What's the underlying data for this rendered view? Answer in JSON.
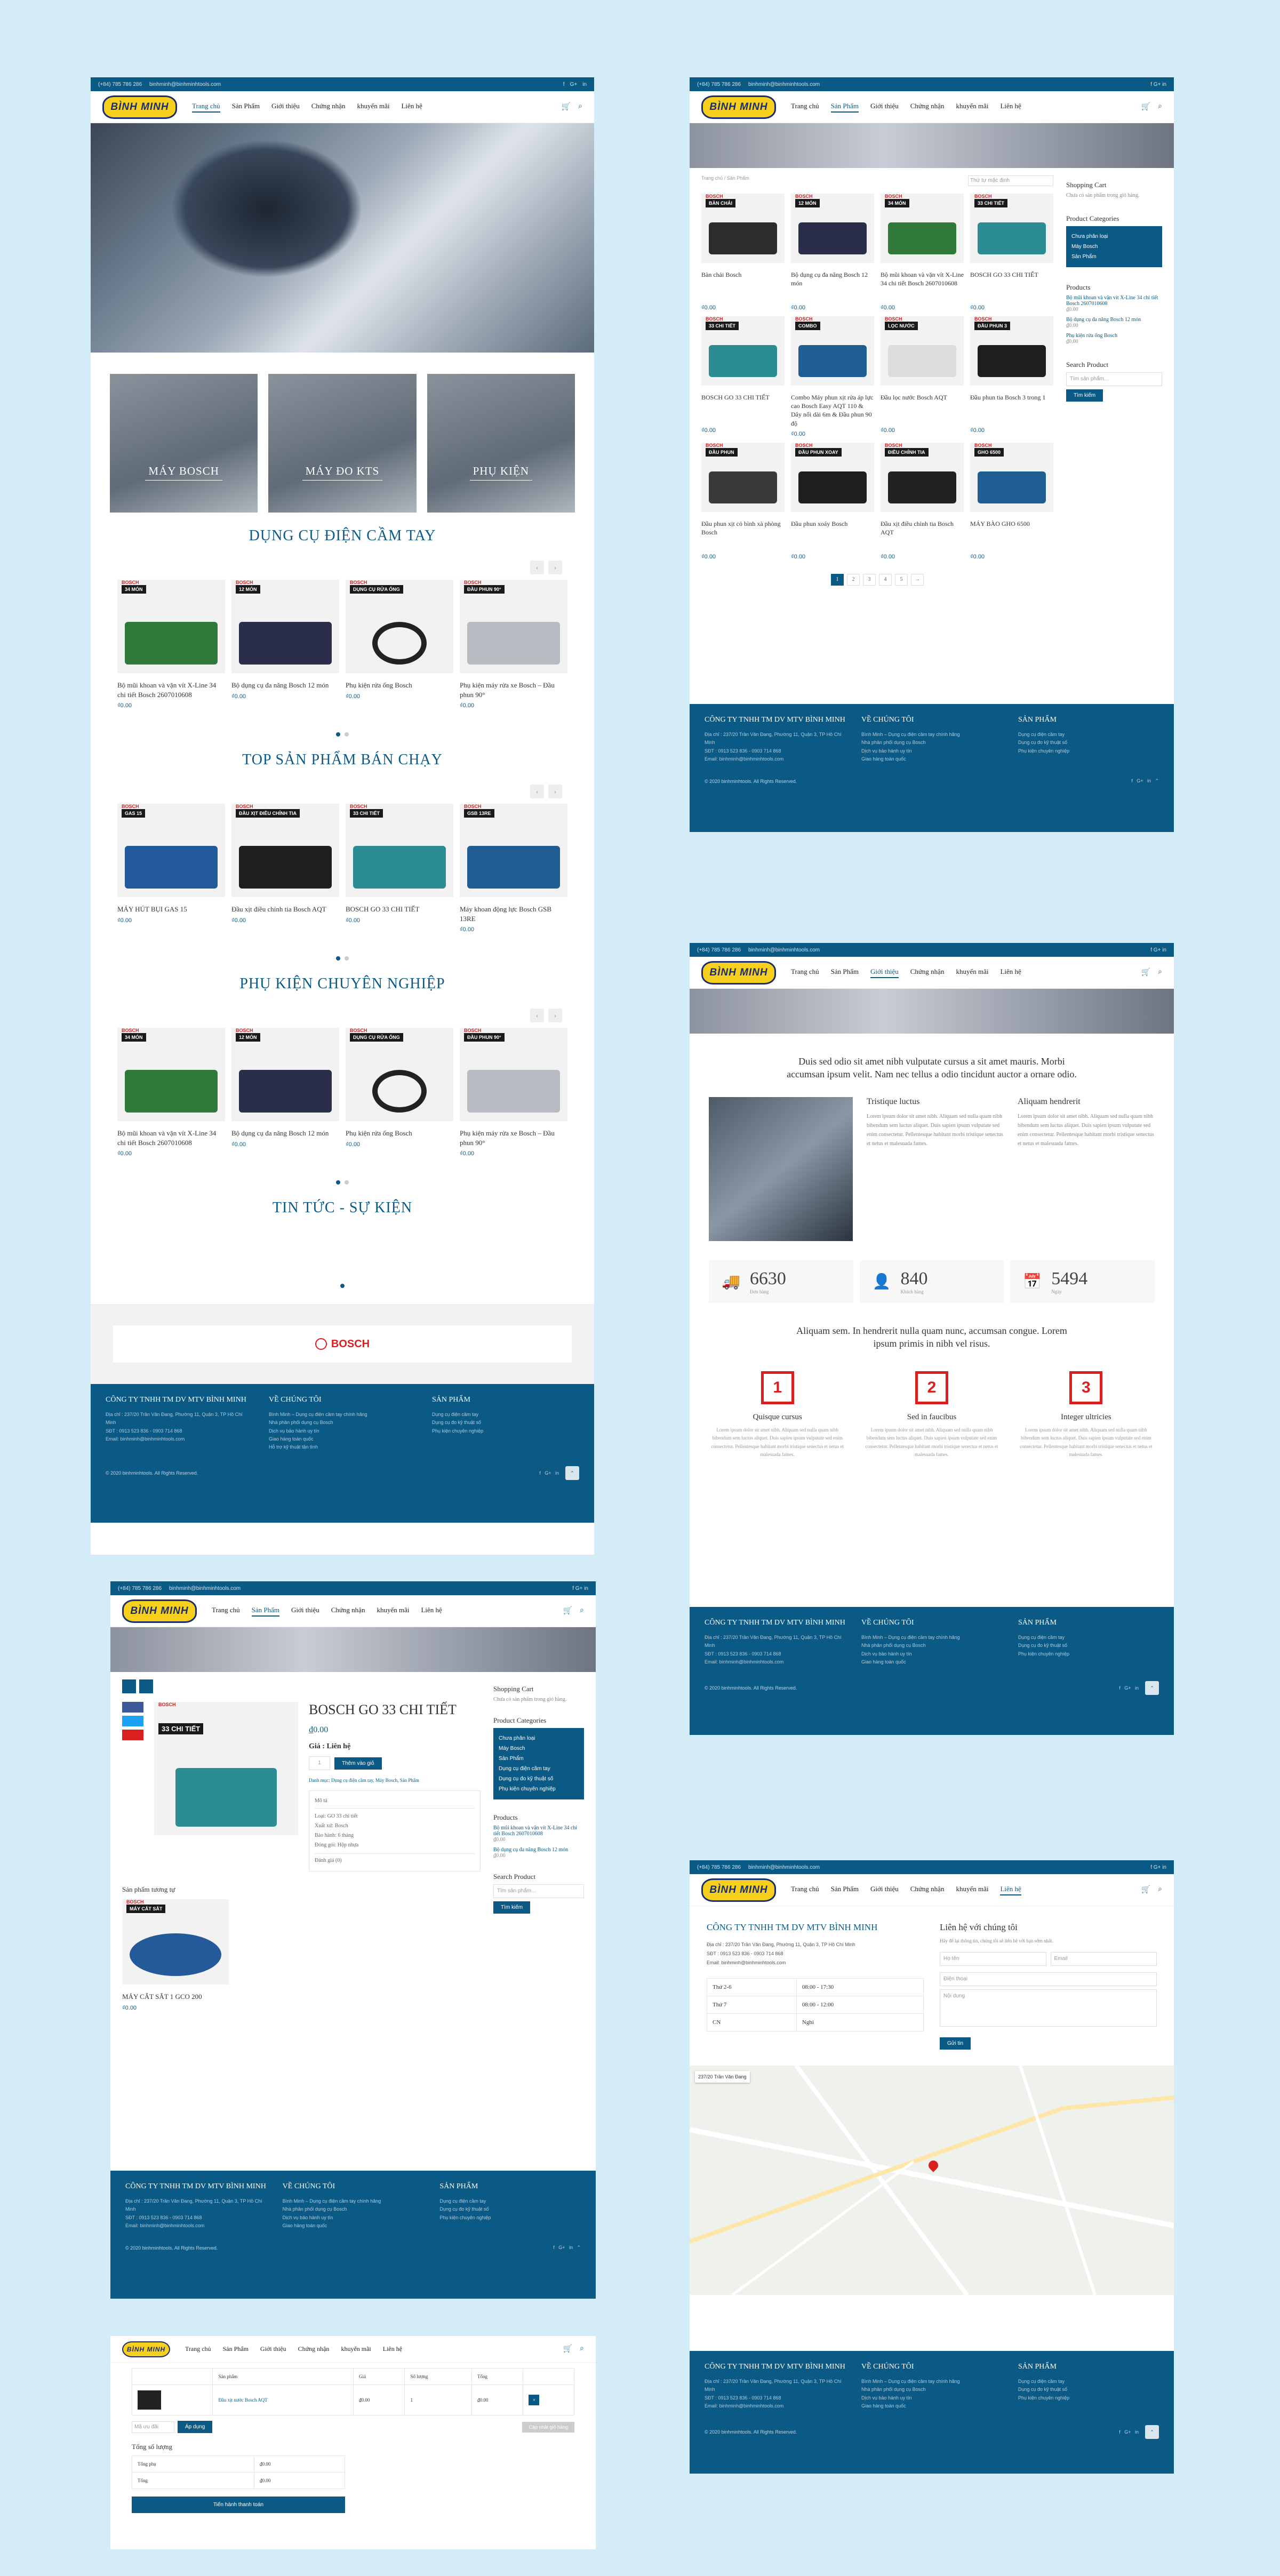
{
  "topbar": {
    "phone": "(+84) 785 786 286",
    "email": "binhminh@binhminhtools.com",
    "social": [
      "f",
      "G+",
      "in"
    ]
  },
  "logo": "BÌNH MINH",
  "menu": [
    "Trang chủ",
    "Sản Phẩm",
    "Giới thiệu",
    "Chứng nhận",
    "khuyến mãi",
    "Liên hệ"
  ],
  "cart": {
    "count": "0",
    "icon": "cart-icon",
    "search_icon": "search-icon"
  },
  "home": {
    "categories": [
      "MÁY BOSCH",
      "MÁY ĐO KTS",
      "PHỤ KIỆN"
    ],
    "sections": [
      {
        "title": "DỤNG CỤ ĐIỆN CẦM TAY",
        "products": [
          {
            "tag": "34 MÓN",
            "name": "Bộ mũi khoan và vặn vít X-Line 34 chi tiết Bosch 2607010608",
            "price": "₫0.00"
          },
          {
            "tag": "12 MÓN",
            "name": "Bộ dụng cụ đa năng Bosch 12 món",
            "price": "₫0.00"
          },
          {
            "tag": "DỤNG CỤ RỬA ỐNG",
            "name": "Phụ kiện rửa ống Bosch",
            "price": "₫0.00"
          },
          {
            "tag": "ĐẦU PHUN 90°",
            "name": "Phụ kiện máy rửa xe Bosch – Đầu phun 90°",
            "price": "₫0.00"
          }
        ]
      },
      {
        "title": "TOP SẢN PHẨM BÁN CHẠY",
        "products": [
          {
            "tag": "GAS 15",
            "name": "MÁY HÚT BỤI GAS 15",
            "price": "₫0.00"
          },
          {
            "tag": "ĐẦU XỊT ĐIỀU CHỈNH TIA",
            "name": "Đầu xịt điều chỉnh tia Bosch AQT",
            "price": "₫0.00"
          },
          {
            "tag": "33 CHI TIẾT",
            "name": "BOSCH GO 33 CHI TIẾT",
            "price": "₫0.00"
          },
          {
            "tag": "GSB 13RE",
            "name": "Máy khoan động lực Bosch GSB 13RE",
            "price": "₫0.00"
          }
        ]
      },
      {
        "title": "PHỤ KIỆN CHUYÊN NGHIỆP",
        "products": [
          {
            "tag": "34 MÓN",
            "name": "Bộ mũi khoan và vặn vít X-Line 34 chi tiết Bosch 2607010608",
            "price": "₫0.00"
          },
          {
            "tag": "12 MÓN",
            "name": "Bộ dụng cụ đa năng Bosch 12 món",
            "price": "₫0.00"
          },
          {
            "tag": "DỤNG CỤ RỬA ỐNG",
            "name": "Phụ kiện rửa ống Bosch",
            "price": "₫0.00"
          },
          {
            "tag": "ĐẦU PHUN 90°",
            "name": "Phụ kiện máy rửa xe Bosch – Đầu phun 90°",
            "price": "₫0.00"
          }
        ]
      }
    ],
    "news_title": "TIN TỨC - SỰ KIỆN",
    "partner": "BOSCH"
  },
  "footer": {
    "company": "CÔNG TY TNHH TM DV MTV BÌNH MINH",
    "address": "Địa chỉ : 237/20 Trần Văn Đang, Phường 11, Quận 3, TP Hồ Chí Minh",
    "phone": "SĐT : 0913 523 836 - 0903 714 868",
    "email": "Email: binhminh@binhminhtools.com",
    "about_title": "VỀ CHÚNG TÔI",
    "about": [
      "Bình Minh – Dụng cụ điện cầm tay chính hãng",
      "Nhà phân phối dụng cụ Bosch",
      "Dịch vụ bảo hành uy tín",
      "Giao hàng toàn quốc",
      "Hỗ trợ kỹ thuật tận tình"
    ],
    "products_title": "SẢN PHẨM",
    "products": [
      "Dụng cụ điện cầm tay",
      "Dụng cụ đo kỹ thuật số",
      "Phụ kiện chuyên nghiệp"
    ],
    "copyright": "© 2020 binhminhtools. All Rights Reserved."
  },
  "shop": {
    "breadcrumb": "Trang chủ / Sản Phẩm",
    "sort": "Thứ tự mặc định",
    "products": [
      {
        "tag": "BÀN CHẢI",
        "name": "Bàn chải Bosch",
        "price": "₫0.00"
      },
      {
        "tag": "12 MÓN",
        "name": "Bộ dụng cụ đa năng Bosch 12 món",
        "price": "₫0.00"
      },
      {
        "tag": "34 MÓN",
        "name": "Bộ mũi khoan và vặn vít X-Line 34 chi tiết Bosch 2607010608",
        "price": "₫0.00"
      },
      {
        "tag": "33 CHI TIẾT",
        "name": "BOSCH GO 33 CHI TIẾT",
        "price": "₫0.00"
      },
      {
        "tag": "33 CHI TIẾT",
        "name": "BOSCH GO 33 CHI TIẾT",
        "price": "₫0.00"
      },
      {
        "tag": "COMBO",
        "name": "Combo Máy phun xịt rửa áp lực cao Bosch Easy AQT 110 & Dây nối dài 6m & Đầu phun 90 độ",
        "price": "₫0.00"
      },
      {
        "tag": "LỌC NƯỚC",
        "name": "Đầu lọc nước Bosch AQT",
        "price": "₫0.00"
      },
      {
        "tag": "ĐẦU PHUN 3",
        "name": "Đầu phun tia Bosch 3 trong 1",
        "price": "₫0.00"
      },
      {
        "tag": "ĐẦU PHUN",
        "name": "Đầu phun xịt cỏ bình xà phòng Bosch",
        "price": "₫0.00"
      },
      {
        "tag": "ĐẦU PHUN XOAY",
        "name": "Đầu phun xoáy Bosch",
        "price": "₫0.00"
      },
      {
        "tag": "ĐIỀU CHỈNH TIA",
        "name": "Đầu xịt điều chỉnh tia Bosch AQT",
        "price": "₫0.00"
      },
      {
        "tag": "GHO 6500",
        "name": "MÁY BÀO GHO 6500",
        "price": "₫0.00"
      }
    ],
    "pages": [
      "1",
      "2",
      "3",
      "4",
      "5",
      "→"
    ],
    "side": {
      "cart_title": "Shopping Cart",
      "cart_empty": "Chưa có sản phẩm trong giỏ hàng.",
      "cat_title": "Product Categories",
      "cats": [
        "Chưa phân loại",
        "Máy Bosch",
        "Sản Phẩm"
      ],
      "prod_title": "Products",
      "prods": [
        {
          "name": "Bộ mũi khoan và vặn vít X-Line 34 chi tiết Bosch 2607010608",
          "price": "₫0.00"
        },
        {
          "name": "Bộ dụng cụ đa năng Bosch 12 món",
          "price": "₫0.00"
        },
        {
          "name": "Phụ kiện rửa ống Bosch",
          "price": "₫0.00"
        }
      ],
      "search_title": "Search Product",
      "search_ph": "Tìm sản phẩm…",
      "search_btn": "Tìm kiếm"
    }
  },
  "about": {
    "intro": "Duis sed odio sit amet nibh vulputate cursus a sit amet mauris. Morbi accumsan ipsum velit. Nam nec tellus a odio tincidunt auctor a ornare odio.",
    "col1_title": "Tristique luctus",
    "col2_title": "Aliquam hendrerit",
    "lorem": "Lorem ipsum dolor sit amet nibh. Aliquam sed nulla quam nibh bibendum sem luctus aliquet. Duis sapien ipsum vulputate sed enim consectetur. Pellentesque habitant morbi tristique senectus et netus et malesuada fames.",
    "stats": [
      {
        "icon": "truck-icon",
        "n": "6630",
        "label": "Đơn hàng"
      },
      {
        "icon": "user-icon",
        "n": "840",
        "label": "Khách hàng"
      },
      {
        "icon": "calendar-icon",
        "n": "5494",
        "label": "Ngày"
      }
    ],
    "mid": "Aliquam sem. In hendrerit nulla quam nunc, accumsan congue. Lorem ipsum primis in nibh vel risus.",
    "steps": [
      {
        "n": "1",
        "t": "Quisque cursus"
      },
      {
        "n": "2",
        "t": "Sed in faucibus"
      },
      {
        "n": "3",
        "t": "Integer ultricies"
      }
    ]
  },
  "product": {
    "title": "BOSCH GO 33 CHI TIẾT",
    "price": "₫0.00",
    "label": "Giá : Liên hệ",
    "qty": "1",
    "add": "Thêm vào giỏ",
    "meta": "Danh mục: Dụng cụ điện cầm tay, Máy Bosch, Sản Phẩm",
    "tab": "Mô tả",
    "specs": [
      "Loại: GO 33 chi tiết",
      "Xuất xứ: Bosch",
      "Bảo hành: 6 tháng",
      "Đóng gói: Hộp nhựa"
    ],
    "review": "Đánh giá (0)",
    "related": "Sản phẩm tương tự",
    "related_item": {
      "tag": "MÁY CẮT SẮT",
      "name": "MÁY CẮT SẮT 1 GCO 200",
      "price": "₫0.00"
    }
  },
  "contact": {
    "company": "CÔNG TY TNHH TM DV MTV BÌNH MINH",
    "form_title": "Liên hệ với chúng tôi",
    "form_note": "Hãy để lại thông tin, chúng tôi sẽ liên hệ với bạn sớm nhất.",
    "fields": [
      "Họ tên",
      "Email",
      "Điện thoại",
      "Nội dung"
    ],
    "send": "Gửi tin",
    "hours": [
      [
        "Thứ 2-6",
        "08:00 - 17:30"
      ],
      [
        "Thứ 7",
        "08:00 - 12:00"
      ],
      [
        "CN",
        "Nghỉ"
      ]
    ],
    "map_label": "237/20 Trần Văn Đang"
  },
  "cart_page": {
    "heads": [
      "Sản phẩm",
      "Giá",
      "Số lượng",
      "Tổng"
    ],
    "item": "Đầu xịt nước Bosch AQT",
    "item_price": "₫0.00",
    "qty": "1",
    "total": "₫0.00",
    "coupon": "Mã ưu đãi",
    "apply": "Áp dụng",
    "update": "Cập nhật giỏ hàng",
    "sum_title": "Tổng số lượng",
    "sub": "Tổng phụ",
    "grand": "Tổng",
    "sub_val": "₫0.00",
    "grand_val": "₫0.00",
    "checkout": "Tiến hành thanh toán"
  }
}
